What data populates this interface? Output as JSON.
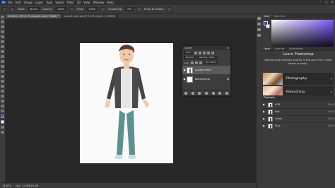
{
  "menubar": {
    "logo": "Ps",
    "items": [
      "File",
      "Edit",
      "Image",
      "Layer",
      "Type",
      "Select",
      "Filter",
      "3D",
      "View",
      "Window",
      "Help"
    ],
    "window_controls": [
      "–",
      "▢",
      "✕"
    ]
  },
  "optionsbar": {
    "mode_label": "Mode:",
    "mode_value": "Brush",
    "opacity_label": "Opacity:",
    "opacity_value": "100%",
    "flow_label": "Flow:",
    "flow_value": "100%",
    "smoothing_label": "Smoothing:",
    "smoothing_value": "0%",
    "erase_history": "Erase to History"
  },
  "tabs": [
    {
      "label": "Untitled-1 @ 16.7% (puppet wave, RGB/8) *",
      "active": true
    },
    {
      "label": "puppet wave.psd @ 33.3% (Layer 1, RGB/8)",
      "active": false
    }
  ],
  "statusbar": {
    "zoom": "16.67%",
    "doc_info": "Doc: 24.9M/19.2M"
  },
  "rightpanel": {
    "tabs": [
      {
        "label": "Color",
        "active": true
      },
      {
        "label": "Swatches",
        "active": false
      }
    ],
    "learn_tabs": [
      {
        "label": "Learn",
        "active": true
      },
      {
        "label": "Libraries",
        "active": false
      },
      {
        "label": "Adjustments",
        "active": false
      }
    ],
    "learn_title": "Learn Photoshop",
    "learn_subtitle": "Step-by-step tutorials directly in the app. Pick a topic below to begin.",
    "cards": [
      {
        "label": "Photography",
        "chevron": "›"
      },
      {
        "label": "Retouching",
        "chevron": "›"
      }
    ],
    "channels_title": "Channels",
    "channels": [
      {
        "name": "RGB",
        "key": "Ctrl+2"
      },
      {
        "name": "Red",
        "key": "Ctrl+3"
      },
      {
        "name": "Green",
        "key": "Ctrl+4"
      },
      {
        "name": "Blue",
        "key": "Ctrl+5"
      }
    ]
  },
  "layers": {
    "title": "Layers",
    "kind": "Kind",
    "blend": "Normal",
    "opacity": "Opacity: 100%",
    "fill": "Fill: 100%",
    "lock_label": "Lock:",
    "items": [
      {
        "name": "puppet wave",
        "selected": true,
        "locked": false
      },
      {
        "name": "Background",
        "selected": false,
        "locked": true
      }
    ]
  },
  "colors": {
    "foreground": "#5c2fd3",
    "accent": "#7a5cff"
  }
}
